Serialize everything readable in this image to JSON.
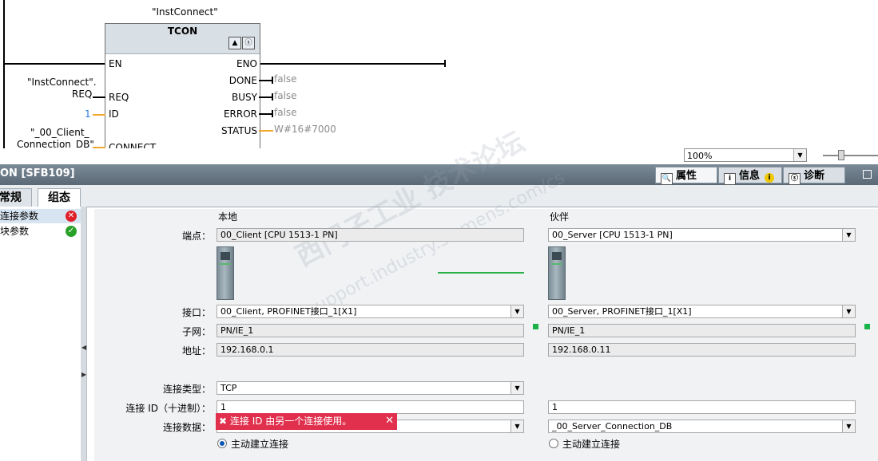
{
  "ladder": {
    "instance_name": "\"InstConnect\"",
    "block_type": "TCON",
    "pins_left": [
      "EN",
      "REQ",
      "ID",
      "CONNECT"
    ],
    "pins_right": [
      "ENO",
      "DONE",
      "BUSY",
      "ERROR",
      "STATUS"
    ],
    "req_operand_line1": "\"InstConnect\".",
    "req_operand_line2": "REQ",
    "id_value": "1",
    "connect_operand_line1": "\"_00_Client_",
    "connect_operand_line2": "Connection_DB\"",
    "done_value": "false",
    "busy_value": "false",
    "error_value": "false",
    "status_value": "W#16#7000"
  },
  "zoom": {
    "value": "100%"
  },
  "inspector": {
    "title": "ON [SFB109]",
    "tabs": {
      "properties": "属性",
      "info": "信息",
      "diagnostics": "诊断"
    }
  },
  "subtabs": {
    "general": "常规",
    "config": "组态"
  },
  "nav": {
    "items": [
      {
        "label": "连接参数",
        "status": "error"
      },
      {
        "label": "块参数",
        "status": "ok"
      }
    ]
  },
  "config": {
    "local_header": "本地",
    "partner_header": "伙伴",
    "labels": {
      "endpoint": "端点：",
      "interface": "接口：",
      "subnet": "子网：",
      "address": "地址：",
      "conn_type": "连接类型：",
      "conn_id": "连接 ID（十进制）：",
      "conn_data": "连接数据："
    },
    "local": {
      "endpoint": "00_Client [CPU 1513-1 PN]",
      "interface": "00_Client, PROFINET接口_1[X1]",
      "subnet": "PN/IE_1",
      "address": "192.168.0.1",
      "conn_type": "TCP",
      "conn_id": "1",
      "conn_data": "",
      "active": "主动建立连接"
    },
    "partner": {
      "endpoint": "00_Server [CPU 1513-1 PN]",
      "interface": "00_Server, PROFINET接口_1[X1]",
      "subnet": "PN/IE_1",
      "address": "192.168.0.11",
      "conn_id": "1",
      "conn_data": "_00_Server_Connection_DB",
      "active": "主动建立连接"
    },
    "error_message": "连接 ID 由另一个连接使用。"
  },
  "watermark": {
    "line1": "西门子工业 技术论坛",
    "line2": "support.industry.siemens.com/cs"
  },
  "colors": {
    "error": "#e0304d",
    "ok": "#2aa22a",
    "network": "#19b34a"
  }
}
